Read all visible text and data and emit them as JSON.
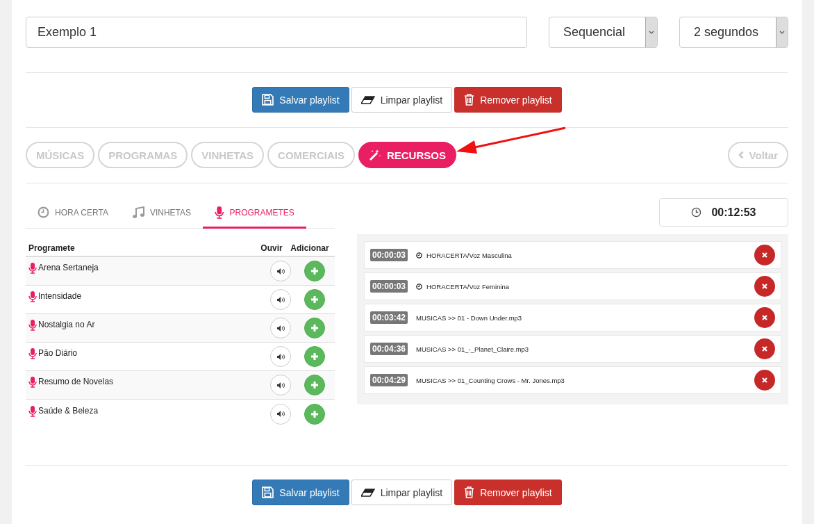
{
  "playlist": {
    "name": "Exemplo 1",
    "mode": "Sequencial",
    "interval": "2 segundos"
  },
  "actions_top": [
    {
      "kind": "save",
      "label": "Salvar playlist"
    },
    {
      "kind": "clear",
      "label": "Limpar playlist"
    },
    {
      "kind": "remove",
      "label": "Remover playlist"
    }
  ],
  "categories": [
    {
      "label": "MÚSICAS",
      "selected": false
    },
    {
      "label": "PROGRAMAS",
      "selected": false
    },
    {
      "label": "VINHETAS",
      "selected": false
    },
    {
      "label": "COMERCIAIS",
      "selected": false
    },
    {
      "label": "RECURSOS",
      "selected": true
    }
  ],
  "back_button": "Voltar",
  "tabs": [
    {
      "kind": "clock",
      "label": "HORA CERTA",
      "selected": false
    },
    {
      "kind": "music",
      "label": "VINHETAS",
      "selected": false
    },
    {
      "kind": "mic",
      "label": "PROGRAMETES",
      "selected": true
    }
  ],
  "table": {
    "columns": [
      "Programete",
      "Ouvir",
      "Adicionar"
    ],
    "rows": [
      {
        "name": "Arena Sertaneja"
      },
      {
        "name": "Intensidade"
      },
      {
        "name": "Nostalgia no Ar"
      },
      {
        "name": "Pão Diário"
      },
      {
        "name": "Resumo de Novelas"
      },
      {
        "name": "Saúde & Beleza"
      }
    ]
  },
  "total_time": "00:12:53",
  "queue": [
    {
      "kind": "hora",
      "duration": "00:00:03",
      "title": "HORACERTA/Voz Masculina"
    },
    {
      "kind": "hora",
      "duration": "00:00:03",
      "title": "HORACERTA/Voz Feminina"
    },
    {
      "kind": "file",
      "duration": "00:03:42",
      "title": "MUSICAS >> 01 - Down Under.mp3"
    },
    {
      "kind": "file",
      "duration": "00:04:36",
      "title": "MUSICAS >> 01_-_Planet_Claire.mp3"
    },
    {
      "kind": "file",
      "duration": "00:04:29",
      "title": "MUSICAS >> 01_Counting Crows - Mr. Jones.mp3"
    }
  ],
  "actions_bottom": [
    {
      "kind": "save",
      "label": "Salvar playlist"
    },
    {
      "kind": "clear",
      "label": "Limpar playlist"
    },
    {
      "kind": "remove",
      "label": "Remover playlist"
    }
  ]
}
